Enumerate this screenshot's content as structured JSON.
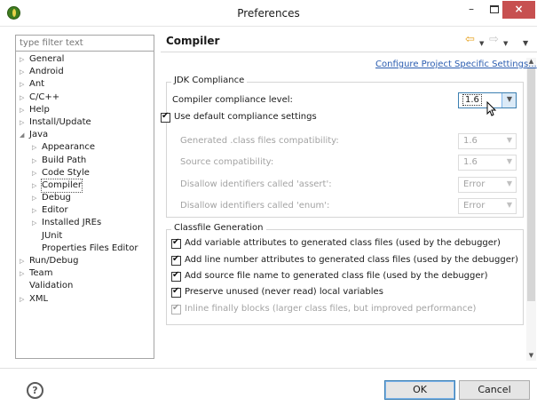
{
  "window": {
    "title": "Preferences",
    "min_glyph": "–",
    "close_glyph": "×"
  },
  "filter": {
    "placeholder": "type filter text"
  },
  "tree": [
    {
      "label": "General",
      "level": 0,
      "toggle": "collapsed"
    },
    {
      "label": "Android",
      "level": 0,
      "toggle": "collapsed"
    },
    {
      "label": "Ant",
      "level": 0,
      "toggle": "collapsed"
    },
    {
      "label": "C/C++",
      "level": 0,
      "toggle": "collapsed"
    },
    {
      "label": "Help",
      "level": 0,
      "toggle": "collapsed"
    },
    {
      "label": "Install/Update",
      "level": 0,
      "toggle": "collapsed"
    },
    {
      "label": "Java",
      "level": 0,
      "toggle": "expanded"
    },
    {
      "label": "Appearance",
      "level": 1,
      "toggle": "collapsed"
    },
    {
      "label": "Build Path",
      "level": 1,
      "toggle": "collapsed"
    },
    {
      "label": "Code Style",
      "level": 1,
      "toggle": "collapsed"
    },
    {
      "label": "Compiler",
      "level": 1,
      "toggle": "collapsed",
      "selected": true
    },
    {
      "label": "Debug",
      "level": 1,
      "toggle": "collapsed"
    },
    {
      "label": "Editor",
      "level": 1,
      "toggle": "collapsed"
    },
    {
      "label": "Installed JREs",
      "level": 1,
      "toggle": "collapsed"
    },
    {
      "label": "JUnit",
      "level": 1,
      "toggle": "none"
    },
    {
      "label": "Properties Files Editor",
      "level": 1,
      "toggle": "none"
    },
    {
      "label": "Run/Debug",
      "level": 0,
      "toggle": "collapsed"
    },
    {
      "label": "Team",
      "level": 0,
      "toggle": "collapsed"
    },
    {
      "label": "Validation",
      "level": 0,
      "toggle": "none"
    },
    {
      "label": "XML",
      "level": 0,
      "toggle": "collapsed"
    }
  ],
  "page": {
    "title": "Compiler",
    "configure_link": "Configure Project Specific Settings...",
    "jdk_group": {
      "title": "JDK Compliance",
      "compliance_label": "Compiler compliance level:",
      "compliance_value": "1.6",
      "use_default_label": "Use default compliance settings",
      "use_default_checked": true,
      "settings": [
        {
          "label": "Generated .class files compatibility:",
          "value": "1.6"
        },
        {
          "label": "Source compatibility:",
          "value": "1.6"
        },
        {
          "label": "Disallow identifiers called 'assert':",
          "value": "Error"
        },
        {
          "label": "Disallow identifiers called 'enum':",
          "value": "Error"
        }
      ]
    },
    "classfile_group": {
      "title": "Classfile Generation",
      "options": [
        {
          "label": "Add variable attributes to generated class files (used by the debugger)",
          "checked": true,
          "enabled": true
        },
        {
          "label": "Add line number attributes to generated class files (used by the debugger)",
          "checked": true,
          "enabled": true
        },
        {
          "label": "Add source file name to generated class file (used by the debugger)",
          "checked": true,
          "enabled": true
        },
        {
          "label": "Preserve unused (never read) local variables",
          "checked": true,
          "enabled": true
        },
        {
          "label": "Inline finally blocks (larger class files, but improved performance)",
          "checked": true,
          "enabled": false
        }
      ]
    }
  },
  "footer": {
    "help_glyph": "?",
    "ok_label": "OK",
    "cancel_label": "Cancel"
  },
  "icons": {
    "app": "eclipse-icon",
    "back": "back-arrow-icon",
    "forward": "forward-arrow-icon",
    "menu": "view-menu-icon",
    "help": "help-icon"
  },
  "colors": {
    "link": "#2a5cb0",
    "close_button": "#c75050",
    "back_arrow": "#e6a11f",
    "focus": "#3c7fb1",
    "disabled_text": "#a3a3a3"
  }
}
